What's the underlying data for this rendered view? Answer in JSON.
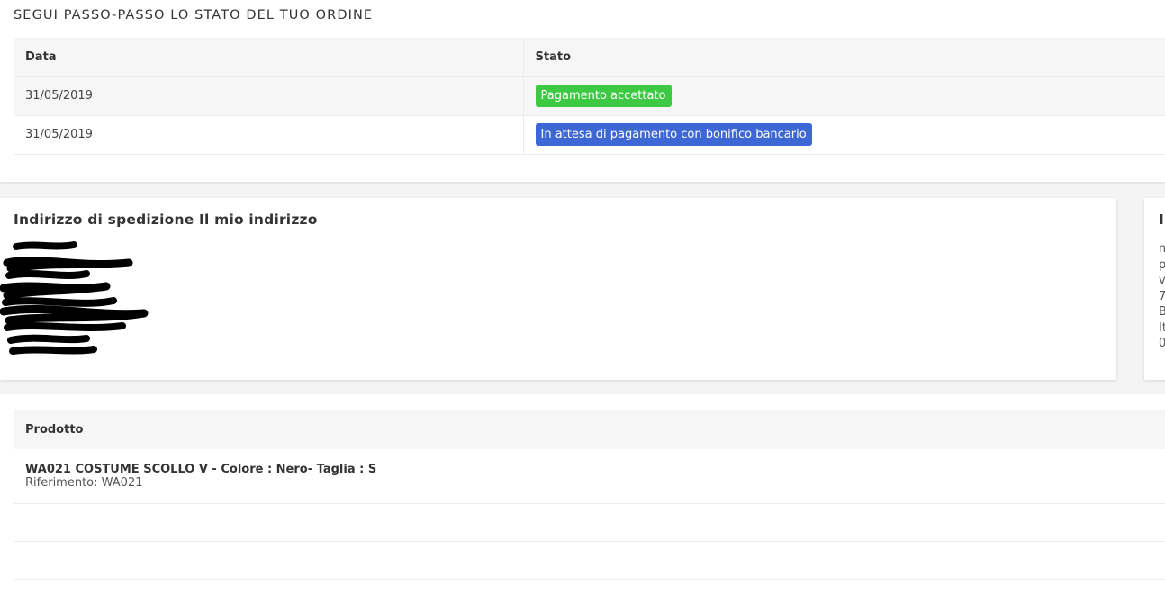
{
  "status_section": {
    "title": "SEGUI PASSO-PASSO LO STATO DEL TUO ORDINE",
    "headers": {
      "date": "Data",
      "status": "Stato"
    },
    "rows": [
      {
        "date": "31/05/2019",
        "status": "Pagamento accettato",
        "color": "#3dc944"
      },
      {
        "date": "31/05/2019",
        "status": "In attesa di pagamento con bonifico bancario",
        "color": "#3e67d6"
      }
    ]
  },
  "shipping_address": {
    "title": "Indirizzo di spedizione Il mio indirizzo",
    "lines": [
      "",
      "",
      "",
      "",
      "",
      "",
      ""
    ]
  },
  "invoice_address": {
    "title": "In",
    "lines": [
      "m",
      "p",
      "v",
      "7",
      "B",
      "It",
      "0"
    ]
  },
  "products": {
    "header": "Prodotto",
    "items": [
      {
        "name": "WA021 COSTUME SCOLLO V - Colore : Nero- Taglia : S",
        "reference": "Riferimento: WA021"
      }
    ]
  }
}
